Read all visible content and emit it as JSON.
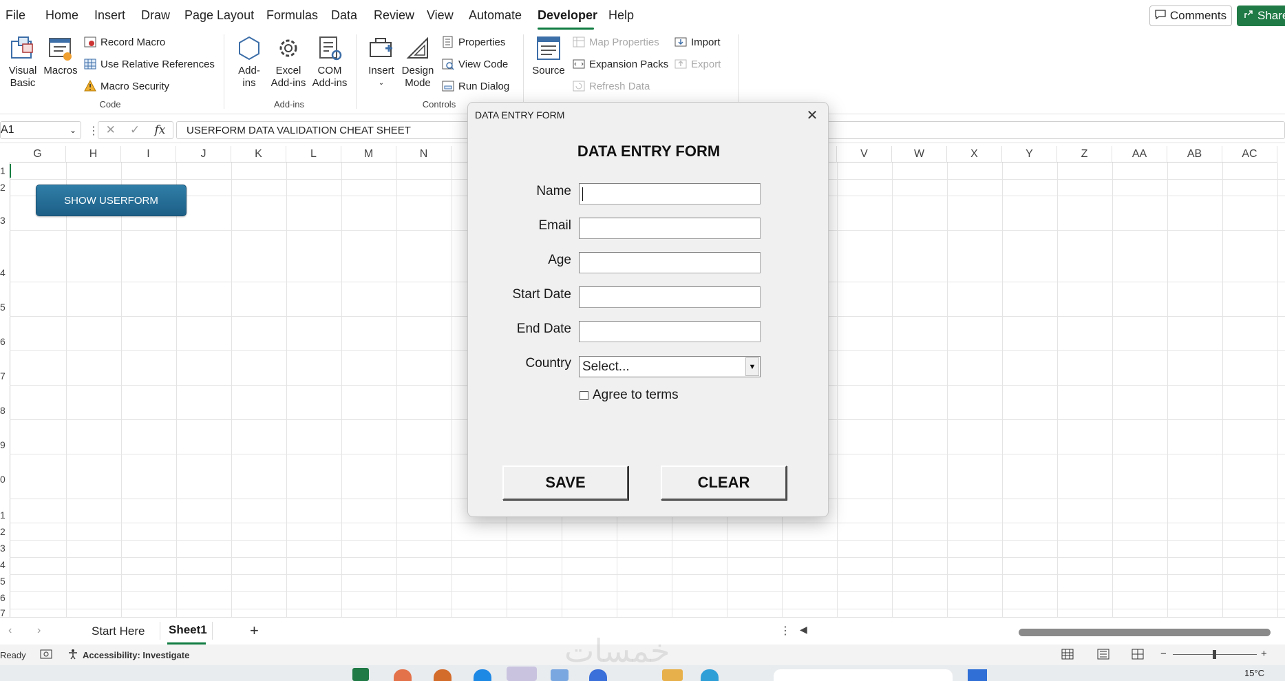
{
  "menu": {
    "items": [
      "File",
      "Home",
      "Insert",
      "Draw",
      "Page Layout",
      "Formulas",
      "Data",
      "Review",
      "View",
      "Automate",
      "Developer",
      "Help"
    ],
    "active": "Developer",
    "comments_label": "Comments",
    "share_label": "Share"
  },
  "ribbon": {
    "code": {
      "visual_basic": "Visual Basic",
      "visual_basic_l1": "Visual",
      "visual_basic_l2": "Basic",
      "macros": "Macros",
      "record_macro": "Record Macro",
      "use_relative": "Use Relative References",
      "macro_security": "Macro Security",
      "label": "Code"
    },
    "addins": {
      "addins_l1": "Add-",
      "addins_l2": "ins",
      "excel_l1": "Excel",
      "excel_l2": "Add-ins",
      "com_l1": "COM",
      "com_l2": "Add-ins",
      "label": "Add-ins"
    },
    "controls": {
      "insert": "Insert",
      "design_l1": "Design",
      "design_l2": "Mode",
      "properties": "Properties",
      "view_code": "View Code",
      "run_dialog": "Run Dialog",
      "label": "Controls"
    },
    "xml": {
      "source": "Source",
      "map_properties": "Map Properties",
      "expansion_packs": "Expansion Packs",
      "refresh_data": "Refresh Data",
      "import": "Import",
      "export": "Export"
    }
  },
  "formula_bar": {
    "name_box": "A1",
    "fx": "fx",
    "content": "USERFORM DATA VALIDATION CHEAT SHEET"
  },
  "grid": {
    "columns_left": [
      "G",
      "H",
      "I",
      "J",
      "K",
      "L",
      "M",
      "N"
    ],
    "columns_right": [
      "V",
      "W",
      "X",
      "Y",
      "Z",
      "AA",
      "AB",
      "AC"
    ],
    "row_numbers": [
      "1",
      "2",
      "3",
      "4",
      "5",
      "6",
      "7",
      "8",
      "9",
      "0",
      "1",
      "2",
      "3",
      "4",
      "5",
      "6",
      "7"
    ],
    "show_userform_label": "SHOW USERFORM"
  },
  "dialog": {
    "title": "DATA ENTRY FORM",
    "heading": "DATA ENTRY FORM",
    "fields": [
      {
        "label": "Name",
        "value": ""
      },
      {
        "label": "Email",
        "value": ""
      },
      {
        "label": "Age",
        "value": ""
      },
      {
        "label": "Start Date",
        "value": ""
      },
      {
        "label": "End Date",
        "value": ""
      }
    ],
    "country_label": "Country",
    "country_value": "Select...",
    "agree_label": "Agree to terms",
    "agree_checked": false,
    "save_label": "SAVE",
    "clear_label": "CLEAR"
  },
  "sheets": {
    "tabs": [
      "Start Here",
      "Sheet1"
    ],
    "active": "Sheet1",
    "add_label": "+"
  },
  "status": {
    "ready": "Ready",
    "accessibility": "Accessibility: Investigate"
  },
  "taskbar": {
    "temperature": "15°C"
  },
  "watermark": "خمسات",
  "colors": {
    "accent_green": "#107c41",
    "share_green": "#1f7a45",
    "userform_button": "#1d5f86",
    "dialog_bg": "#f0f0f0"
  }
}
